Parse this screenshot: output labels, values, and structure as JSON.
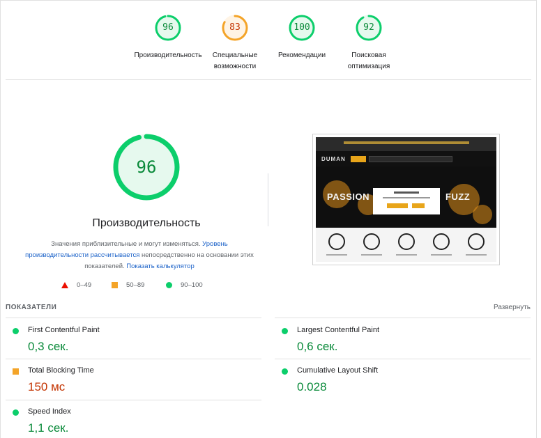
{
  "top_scores": [
    {
      "score": "96",
      "label_line1": "Производительность",
      "label_line2": "",
      "color": "#0cce6b",
      "text_color": "#0a8a3a",
      "fraction": 0.96
    },
    {
      "score": "83",
      "label_line1": "Специальные",
      "label_line2": "возможности",
      "color": "#f4a428",
      "text_color": "#c33300",
      "fraction": 0.83
    },
    {
      "score": "100",
      "label_line1": "Рекомендации",
      "label_line2": "",
      "color": "#0cce6b",
      "text_color": "#0a8a3a",
      "fraction": 1.0
    },
    {
      "score": "92",
      "label_line1": "Поисковая",
      "label_line2": "оптимизация",
      "color": "#0cce6b",
      "text_color": "#0a8a3a",
      "fraction": 0.92
    }
  ],
  "main": {
    "score": "96",
    "fraction": 0.96,
    "title": "Производительность",
    "desc_part1": "Значения приблизительные и могут изменяться. ",
    "desc_link1": "Уровень производительности рассчитывается",
    "desc_part2": " непосредственно на основании этих показателей. ",
    "desc_link2": "Показать калькулятор"
  },
  "legend": {
    "fail": "0–49",
    "average": "50–89",
    "pass": "90–100"
  },
  "thumbnail": {
    "logo": "DUMAN",
    "word_left": "PASSION",
    "word_right": "FUZZ"
  },
  "metrics_section": {
    "header": "ПОКАЗАТЕЛИ",
    "expand_label": "Развернуть"
  },
  "metrics": [
    {
      "name": "First Contentful Paint",
      "value": "0,3 сек.",
      "status": "pass"
    },
    {
      "name": "Largest Contentful Paint",
      "value": "0,6 сек.",
      "status": "pass"
    },
    {
      "name": "Total Blocking Time",
      "value": "150 мс",
      "status": "average"
    },
    {
      "name": "Cumulative Layout Shift",
      "value": "0.028",
      "status": "pass"
    },
    {
      "name": "Speed Index",
      "value": "1,1 сек.",
      "status": "pass"
    }
  ],
  "colors": {
    "pass": "#0cce6b",
    "average": "#f4a428",
    "fail": "#eb0f00",
    "link": "#1a61c8"
  }
}
